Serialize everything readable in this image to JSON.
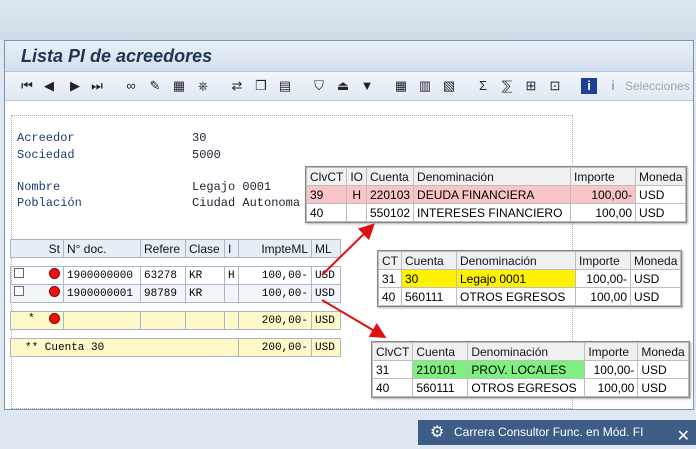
{
  "window": {
    "title": "Lista PI de acreedores"
  },
  "toolbar": {
    "icons": [
      "first-page",
      "prev-page",
      "next-page",
      "last-page",
      "glasses",
      "pencil",
      "grid",
      "stamp",
      "doc-arrows",
      "doc-copy",
      "doc-note",
      "filter",
      "sum-up",
      "filter-2",
      "table",
      "table-sort",
      "table-col",
      "sigma",
      "sigma-x",
      "layout",
      "layout-2",
      "info"
    ],
    "selecciones_label": "Selecciones"
  },
  "header": {
    "acreedor_label": "Acreedor",
    "acreedor_value": "30",
    "sociedad_label": "Sociedad",
    "sociedad_value": "5000",
    "nombre_label": "Nombre",
    "nombre_value": "Legajo 0001",
    "poblacion_label": "Población",
    "poblacion_value": "Ciudad Autonoma"
  },
  "list": {
    "columns": [
      "St",
      "N° doc.",
      "Refere",
      "Clase",
      "I",
      "ImpteML",
      "ML"
    ],
    "rows": [
      {
        "doc": "1900000000",
        "ref": "63278",
        "clase": "KR",
        "i": "H",
        "importe": "100,00-",
        "ml": "USD"
      },
      {
        "doc": "1900000001",
        "ref": "98789",
        "clase": "KR",
        "i": "",
        "importe": "100,00-",
        "ml": "USD"
      }
    ],
    "subtotal": {
      "mark": "*",
      "importe": "200,00-",
      "ml": "USD"
    },
    "total": {
      "label": "** Cuenta 30",
      "importe": "200,00-",
      "ml": "USD"
    }
  },
  "popup1": {
    "headers": [
      "ClvCT",
      "IO",
      "Cuenta",
      "Denominación",
      "Importe",
      "Moneda"
    ],
    "rows": [
      [
        "39",
        "H",
        "220103",
        "DEUDA FINANCIERA",
        "100,00-",
        "USD"
      ],
      [
        "40",
        "",
        "550102",
        "INTERESES FINANCIERO",
        "100,00",
        "USD"
      ]
    ]
  },
  "popup2": {
    "headers": [
      "CT",
      "Cuenta",
      "Denominación",
      "Importe",
      "Moneda"
    ],
    "rows": [
      [
        "31",
        "30",
        "Legajo 0001",
        "100,00-",
        "USD"
      ],
      [
        "40",
        "560111",
        "OTROS EGRESOS",
        "100,00",
        "USD"
      ]
    ]
  },
  "popup3": {
    "headers": [
      "ClvCT",
      "Cuenta",
      "Denominación",
      "Importe",
      "Moneda"
    ],
    "rows": [
      [
        "31",
        "210101",
        "PROV. LOCALES",
        "100,00-",
        "USD"
      ],
      [
        "40",
        "560111",
        "OTROS EGRESOS",
        "100,00",
        "USD"
      ]
    ]
  },
  "watermark": {
    "text": "Carrera Consultor Func. en Mód. FI"
  },
  "colors": {
    "arrow": "#e01010",
    "pink": "#f9c5c8",
    "yellow": "#fff200",
    "green": "#7ff07f"
  }
}
